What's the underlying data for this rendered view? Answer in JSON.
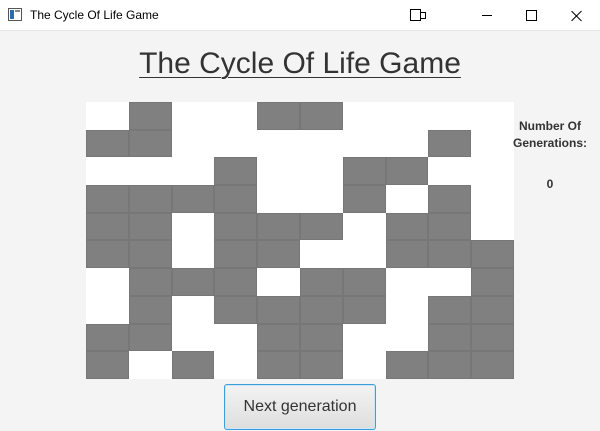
{
  "window": {
    "title": "The Cycle Of Life Game"
  },
  "main": {
    "heading": "The Cycle Of Life Game",
    "generations_label": "Number Of Generations:",
    "generations_count": "0",
    "next_button_label": "Next generation"
  },
  "colors": {
    "alive_cell": "#808080",
    "dead_cell": "#ffffff",
    "button_focus_border": "#3c9ed9"
  },
  "grid": {
    "rows": 10,
    "cols": 10,
    "cells": [
      [
        0,
        1,
        0,
        0,
        1,
        1,
        0,
        0,
        0,
        0
      ],
      [
        1,
        1,
        0,
        0,
        0,
        0,
        0,
        0,
        1,
        0
      ],
      [
        0,
        0,
        0,
        1,
        0,
        0,
        1,
        1,
        0,
        0
      ],
      [
        1,
        1,
        1,
        1,
        0,
        0,
        1,
        0,
        1,
        0
      ],
      [
        1,
        1,
        0,
        1,
        1,
        1,
        0,
        1,
        1,
        0
      ],
      [
        1,
        1,
        0,
        1,
        1,
        0,
        0,
        1,
        1,
        1
      ],
      [
        0,
        1,
        1,
        1,
        0,
        1,
        1,
        0,
        0,
        1
      ],
      [
        0,
        1,
        0,
        1,
        1,
        1,
        1,
        0,
        1,
        1
      ],
      [
        1,
        1,
        0,
        0,
        1,
        1,
        0,
        0,
        1,
        1
      ],
      [
        1,
        0,
        1,
        0,
        1,
        1,
        0,
        1,
        1,
        1
      ]
    ]
  }
}
